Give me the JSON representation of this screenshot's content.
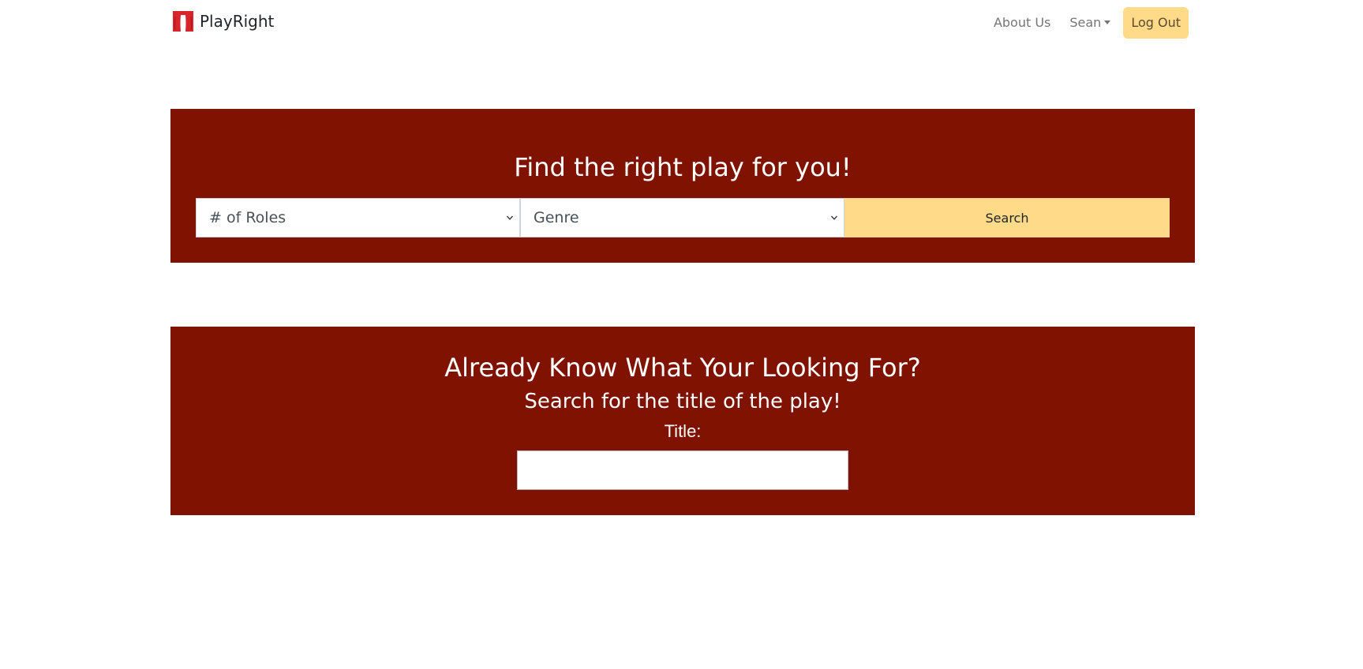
{
  "header": {
    "brand": "PlayRight",
    "nav": {
      "about_label": "About Us",
      "user_label": "Sean",
      "logout_label": "Log Out"
    }
  },
  "finder": {
    "heading": "Find the right play for you!",
    "roles_select": "# of Roles",
    "genre_select": "Genre",
    "search_label": "Search"
  },
  "title_search": {
    "heading": "Already Know What Your Looking For?",
    "subheading": "Search for the title of the play!",
    "title_label": "Title:",
    "title_value": ""
  },
  "colors": {
    "panel_bg": "#7f1200",
    "accent_button": "#ffda88",
    "logo_red": "#d8242b"
  }
}
